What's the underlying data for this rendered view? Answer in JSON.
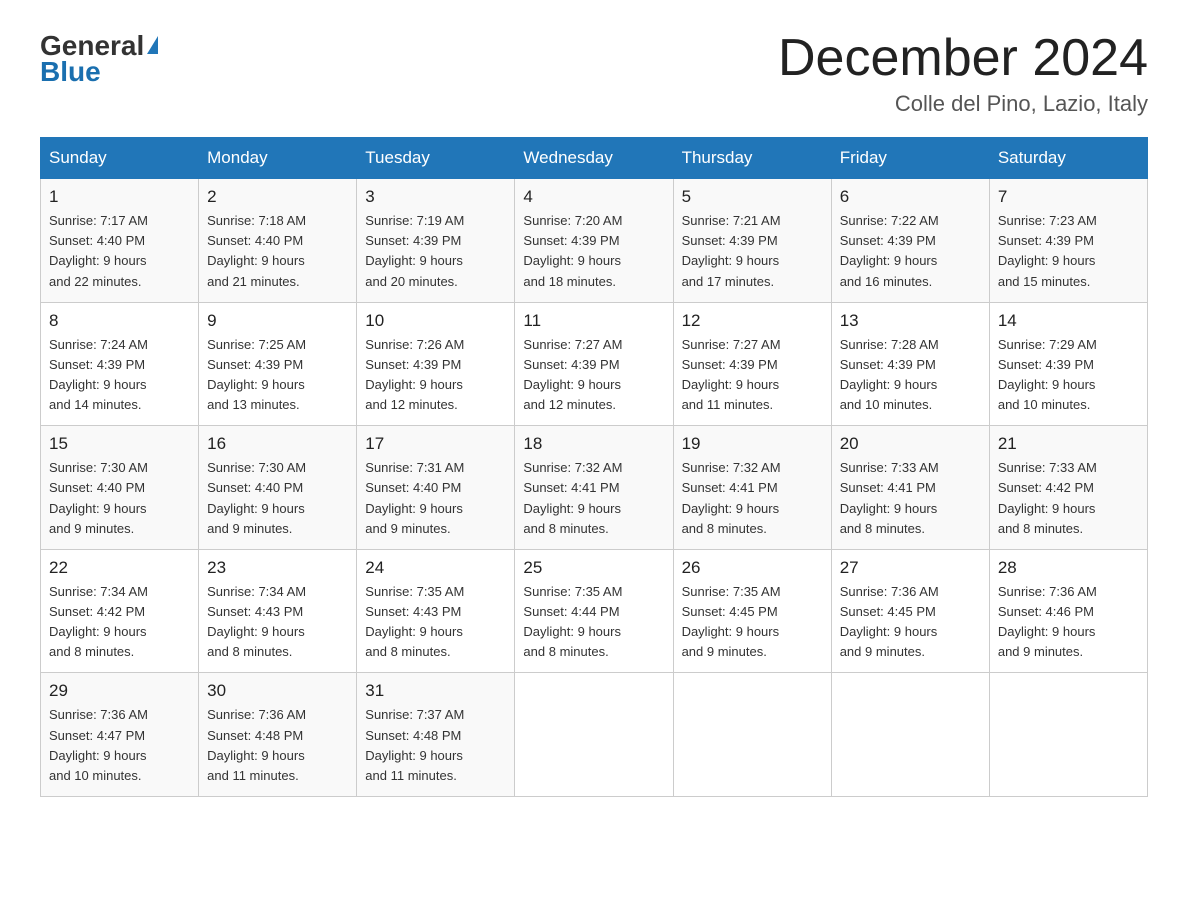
{
  "header": {
    "logo_general": "General",
    "logo_blue": "Blue",
    "month_title": "December 2024",
    "location": "Colle del Pino, Lazio, Italy"
  },
  "days_of_week": [
    "Sunday",
    "Monday",
    "Tuesday",
    "Wednesday",
    "Thursday",
    "Friday",
    "Saturday"
  ],
  "weeks": [
    [
      {
        "day": "1",
        "sunrise": "7:17 AM",
        "sunset": "4:40 PM",
        "daylight": "9 hours and 22 minutes."
      },
      {
        "day": "2",
        "sunrise": "7:18 AM",
        "sunset": "4:40 PM",
        "daylight": "9 hours and 21 minutes."
      },
      {
        "day": "3",
        "sunrise": "7:19 AM",
        "sunset": "4:39 PM",
        "daylight": "9 hours and 20 minutes."
      },
      {
        "day": "4",
        "sunrise": "7:20 AM",
        "sunset": "4:39 PM",
        "daylight": "9 hours and 18 minutes."
      },
      {
        "day": "5",
        "sunrise": "7:21 AM",
        "sunset": "4:39 PM",
        "daylight": "9 hours and 17 minutes."
      },
      {
        "day": "6",
        "sunrise": "7:22 AM",
        "sunset": "4:39 PM",
        "daylight": "9 hours and 16 minutes."
      },
      {
        "day": "7",
        "sunrise": "7:23 AM",
        "sunset": "4:39 PM",
        "daylight": "9 hours and 15 minutes."
      }
    ],
    [
      {
        "day": "8",
        "sunrise": "7:24 AM",
        "sunset": "4:39 PM",
        "daylight": "9 hours and 14 minutes."
      },
      {
        "day": "9",
        "sunrise": "7:25 AM",
        "sunset": "4:39 PM",
        "daylight": "9 hours and 13 minutes."
      },
      {
        "day": "10",
        "sunrise": "7:26 AM",
        "sunset": "4:39 PM",
        "daylight": "9 hours and 12 minutes."
      },
      {
        "day": "11",
        "sunrise": "7:27 AM",
        "sunset": "4:39 PM",
        "daylight": "9 hours and 12 minutes."
      },
      {
        "day": "12",
        "sunrise": "7:27 AM",
        "sunset": "4:39 PM",
        "daylight": "9 hours and 11 minutes."
      },
      {
        "day": "13",
        "sunrise": "7:28 AM",
        "sunset": "4:39 PM",
        "daylight": "9 hours and 10 minutes."
      },
      {
        "day": "14",
        "sunrise": "7:29 AM",
        "sunset": "4:39 PM",
        "daylight": "9 hours and 10 minutes."
      }
    ],
    [
      {
        "day": "15",
        "sunrise": "7:30 AM",
        "sunset": "4:40 PM",
        "daylight": "9 hours and 9 minutes."
      },
      {
        "day": "16",
        "sunrise": "7:30 AM",
        "sunset": "4:40 PM",
        "daylight": "9 hours and 9 minutes."
      },
      {
        "day": "17",
        "sunrise": "7:31 AM",
        "sunset": "4:40 PM",
        "daylight": "9 hours and 9 minutes."
      },
      {
        "day": "18",
        "sunrise": "7:32 AM",
        "sunset": "4:41 PM",
        "daylight": "9 hours and 8 minutes."
      },
      {
        "day": "19",
        "sunrise": "7:32 AM",
        "sunset": "4:41 PM",
        "daylight": "9 hours and 8 minutes."
      },
      {
        "day": "20",
        "sunrise": "7:33 AM",
        "sunset": "4:41 PM",
        "daylight": "9 hours and 8 minutes."
      },
      {
        "day": "21",
        "sunrise": "7:33 AM",
        "sunset": "4:42 PM",
        "daylight": "9 hours and 8 minutes."
      }
    ],
    [
      {
        "day": "22",
        "sunrise": "7:34 AM",
        "sunset": "4:42 PM",
        "daylight": "9 hours and 8 minutes."
      },
      {
        "day": "23",
        "sunrise": "7:34 AM",
        "sunset": "4:43 PM",
        "daylight": "9 hours and 8 minutes."
      },
      {
        "day": "24",
        "sunrise": "7:35 AM",
        "sunset": "4:43 PM",
        "daylight": "9 hours and 8 minutes."
      },
      {
        "day": "25",
        "sunrise": "7:35 AM",
        "sunset": "4:44 PM",
        "daylight": "9 hours and 8 minutes."
      },
      {
        "day": "26",
        "sunrise": "7:35 AM",
        "sunset": "4:45 PM",
        "daylight": "9 hours and 9 minutes."
      },
      {
        "day": "27",
        "sunrise": "7:36 AM",
        "sunset": "4:45 PM",
        "daylight": "9 hours and 9 minutes."
      },
      {
        "day": "28",
        "sunrise": "7:36 AM",
        "sunset": "4:46 PM",
        "daylight": "9 hours and 9 minutes."
      }
    ],
    [
      {
        "day": "29",
        "sunrise": "7:36 AM",
        "sunset": "4:47 PM",
        "daylight": "9 hours and 10 minutes."
      },
      {
        "day": "30",
        "sunrise": "7:36 AM",
        "sunset": "4:48 PM",
        "daylight": "9 hours and 11 minutes."
      },
      {
        "day": "31",
        "sunrise": "7:37 AM",
        "sunset": "4:48 PM",
        "daylight": "9 hours and 11 minutes."
      },
      null,
      null,
      null,
      null
    ]
  ],
  "labels": {
    "sunrise_prefix": "Sunrise: ",
    "sunset_prefix": "Sunset: ",
    "daylight_prefix": "Daylight: "
  }
}
